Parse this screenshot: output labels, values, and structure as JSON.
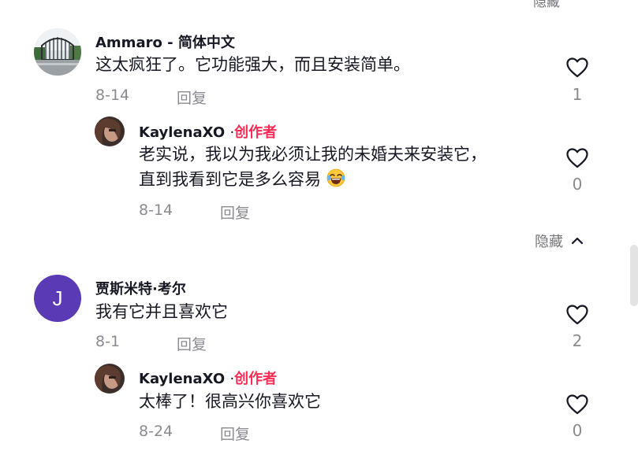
{
  "top_cut_text": "隐藏",
  "colors": {
    "creator_accent": "#fe2c55",
    "avatar_j": "#5a3bb5",
    "meta_gray": "#8a8b91"
  },
  "comments": [
    {
      "author": "Ammaro - 简体中文",
      "text": "这太疯狂了。它功能强大，而且安装简单。",
      "date": "8-14",
      "reply_label": "回复",
      "likes": "1",
      "avatar_icon": "gate-photo-avatar"
    },
    {
      "author": "KaylenaXO",
      "separator": "·",
      "creator_badge": "创作者",
      "text_line1": "老实说，我以为我必须让我的未婚夫来安装它，",
      "text_line2": "直到我看到它是多么容易",
      "emoji_icon": "laughing-crying-face-emoji",
      "date": "8-14",
      "reply_label": "回复",
      "likes": "0"
    },
    {
      "author": "贾斯米特·考尔",
      "avatar_letter": "J",
      "text": "我有它并且喜欢它",
      "date": "8-1",
      "reply_label": "回复",
      "likes": "2"
    },
    {
      "author": "KaylenaXO",
      "separator": "·",
      "creator_badge": "创作者",
      "text": "太棒了！很高兴你喜欢它",
      "date": "8-24",
      "reply_label": "回复",
      "likes": "0"
    }
  ],
  "hide_replies_label": "隐藏"
}
